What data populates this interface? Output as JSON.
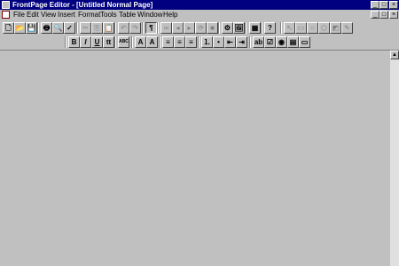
{
  "window": {
    "title": "FrontPage Editor - [Untitled Normal Page]"
  },
  "caption_buttons": {
    "minimize": "_",
    "maximize": "□",
    "close": "×"
  },
  "menu": [
    {
      "label": "File"
    },
    {
      "label": "Edit"
    },
    {
      "label": "View"
    },
    {
      "label": "Insert"
    },
    {
      "label": "Format"
    },
    {
      "label": "Tools"
    },
    {
      "label": "Table"
    },
    {
      "label": "Window"
    },
    {
      "label": "Help"
    }
  ],
  "toolbar_standard": [
    {
      "name": "new-icon",
      "glyph": "🗋",
      "enabled": true
    },
    {
      "name": "open-icon",
      "glyph": "📂",
      "enabled": true
    },
    {
      "name": "save-icon",
      "glyph": "💾",
      "enabled": true
    },
    {
      "name": "print-icon",
      "glyph": "🖶",
      "enabled": true
    },
    {
      "name": "print-preview-icon",
      "glyph": "🔍",
      "enabled": true
    },
    {
      "name": "spelling-icon",
      "glyph": "✓",
      "enabled": true
    },
    {
      "name": "cut-icon",
      "glyph": "✂",
      "enabled": false
    },
    {
      "name": "copy-icon",
      "glyph": "⎘",
      "enabled": false
    },
    {
      "name": "paste-icon",
      "glyph": "📋",
      "enabled": false
    },
    {
      "name": "undo-icon",
      "glyph": "↶",
      "enabled": false
    },
    {
      "name": "redo-icon",
      "glyph": "↷",
      "enabled": false
    },
    {
      "name": "show-all-icon",
      "glyph": "¶",
      "enabled": true
    },
    {
      "name": "link-icon",
      "glyph": "∞",
      "enabled": false
    },
    {
      "name": "back-icon",
      "glyph": "◂",
      "enabled": false
    },
    {
      "name": "forward-icon",
      "glyph": "▸",
      "enabled": false
    },
    {
      "name": "refresh-icon",
      "glyph": "⟳",
      "enabled": false
    },
    {
      "name": "stop-icon",
      "glyph": "■",
      "enabled": false
    },
    {
      "name": "bot-icon",
      "glyph": "⚙",
      "enabled": true
    },
    {
      "name": "insert-image-icon",
      "glyph": "🖼",
      "enabled": true
    },
    {
      "name": "insert-table-icon",
      "glyph": "▦",
      "enabled": true
    },
    {
      "name": "help-icon",
      "glyph": "?",
      "enabled": true
    },
    {
      "name": "select-icon",
      "glyph": "↖",
      "enabled": false
    },
    {
      "name": "rectangle-icon",
      "glyph": "▭",
      "enabled": false
    },
    {
      "name": "circle-icon",
      "glyph": "○",
      "enabled": false
    },
    {
      "name": "polygon-icon",
      "glyph": "⬠",
      "enabled": false
    },
    {
      "name": "hotspot-icon",
      "glyph": "◩",
      "enabled": false
    },
    {
      "name": "pencil-icon",
      "glyph": "✎",
      "enabled": false
    }
  ],
  "toolbar_format": [
    {
      "name": "bold-button",
      "glyph": "B"
    },
    {
      "name": "italic-button",
      "glyph": "I"
    },
    {
      "name": "underline-button",
      "glyph": "U"
    },
    {
      "name": "typewriter-button",
      "glyph": "tt"
    },
    {
      "name": "text-color-icon",
      "glyph": "ABC"
    },
    {
      "name": "increase-font-icon",
      "glyph": "A"
    },
    {
      "name": "decrease-font-icon",
      "glyph": "A"
    },
    {
      "name": "align-left-icon",
      "glyph": "≡"
    },
    {
      "name": "align-center-icon",
      "glyph": "≡"
    },
    {
      "name": "align-right-icon",
      "glyph": "≡"
    },
    {
      "name": "numbered-list-icon",
      "glyph": "⒈"
    },
    {
      "name": "bulleted-list-icon",
      "glyph": "•"
    },
    {
      "name": "decrease-indent-icon",
      "glyph": "⇤"
    },
    {
      "name": "increase-indent-icon",
      "glyph": "⇥"
    },
    {
      "name": "form-field-icon",
      "glyph": "ab"
    },
    {
      "name": "checkbox-field-icon",
      "glyph": "☑"
    },
    {
      "name": "radio-field-icon",
      "glyph": "◉"
    },
    {
      "name": "dropdown-field-icon",
      "glyph": "▤"
    },
    {
      "name": "push-button-icon",
      "glyph": "▭"
    }
  ],
  "style_box": {
    "value": ""
  }
}
